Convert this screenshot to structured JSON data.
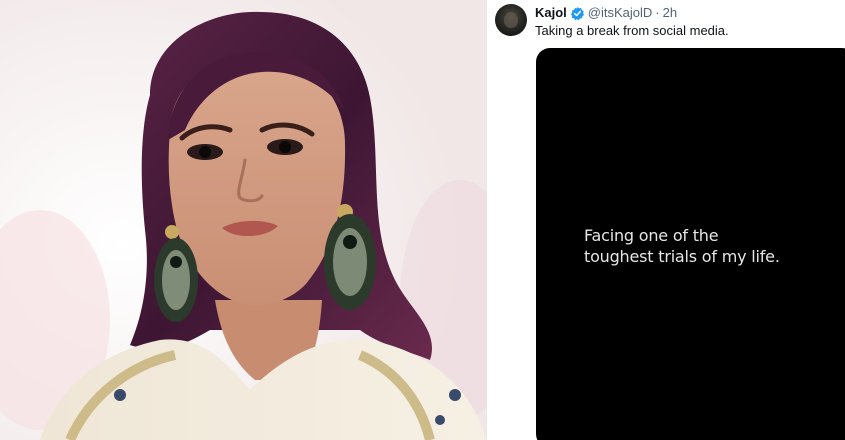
{
  "photo": {
    "alt_icon": "portrait-photo"
  },
  "tweet": {
    "display_name": "Kajol",
    "handle": "@itsKajolD",
    "separator": "·",
    "time": "2h",
    "text": "Taking a break from social media.",
    "verified": true,
    "verified_color": "#1d9bf0",
    "media": {
      "background": "#000000",
      "lines": [
        "Facing one of the",
        "toughest trials of my life."
      ]
    }
  }
}
